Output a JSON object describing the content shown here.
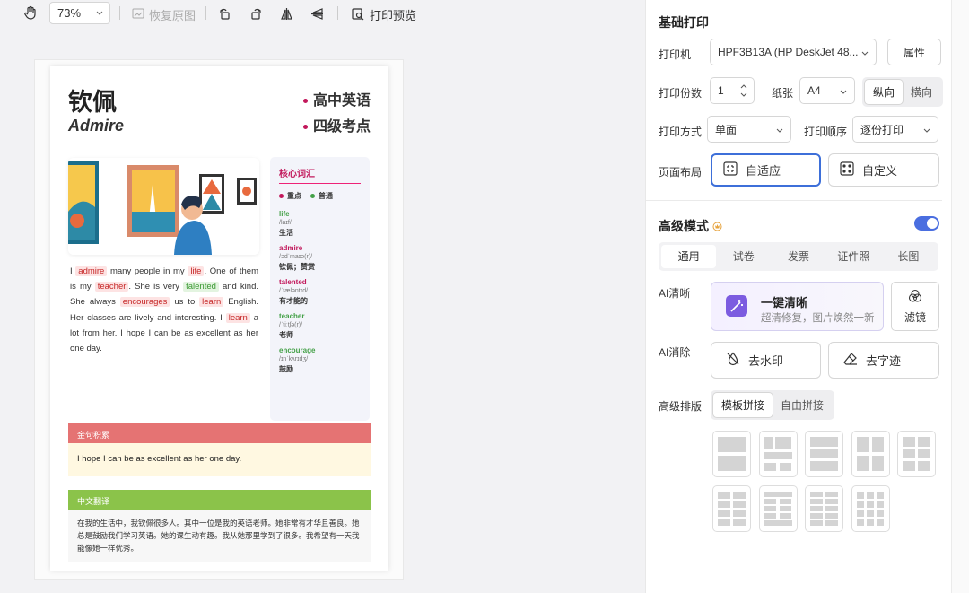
{
  "toolbar": {
    "zoom": "73%",
    "restore": "恢复原图",
    "preview": "打印预览"
  },
  "doc": {
    "title": "钦佩",
    "subtitle": "Admire",
    "tag1": "高中英语",
    "tag2": "四级考点",
    "para": [
      {
        "t": "I "
      },
      {
        "t": "admire",
        "h": "r"
      },
      {
        "t": " many people in my "
      },
      {
        "t": "life",
        "h": "r"
      },
      {
        "t": ". One of them is my "
      },
      {
        "t": "teacher",
        "h": "r"
      },
      {
        "t": ". She is very "
      },
      {
        "t": "talented",
        "h": "g"
      },
      {
        "t": " and kind. She always "
      },
      {
        "t": "encourages",
        "h": "r"
      },
      {
        "t": " us to "
      },
      {
        "t": "learn",
        "h": "r"
      },
      {
        "t": " English. Her classes are lively and interesting. I "
      },
      {
        "t": "learn",
        "h": "r"
      },
      {
        "t": " a lot from her. I hope I can be as excellent as her one day."
      }
    ],
    "vocab_title": "核心词汇",
    "legend_key": "重点",
    "legend_normal": "普通",
    "vocab": [
      {
        "word": "life",
        "phon": "/laɪf/",
        "mean": "生活",
        "color": "#43a047"
      },
      {
        "word": "admire",
        "phon": "/ədˈmaɪə(r)/",
        "mean": "钦佩；赞赏",
        "color": "#c2185b"
      },
      {
        "word": "talented",
        "phon": "/ˈtæləntɪd/",
        "mean": "有才能的",
        "color": "#c2185b"
      },
      {
        "word": "teacher",
        "phon": "/ˈtiːtʃə(r)/",
        "mean": "老师",
        "color": "#43a047"
      },
      {
        "word": "encourage",
        "phon": "/ɪnˈkʌrɪdʒ/",
        "mean": "鼓励",
        "color": "#43a047"
      }
    ],
    "quote_title": "金句积累",
    "quote": "I hope I can be as excellent as her one day.",
    "trans_title": "中文翻译",
    "trans": "在我的生活中，我钦佩很多人。其中一位是我的英语老师。她非常有才华且善良。她总是鼓励我们学习英语。她的课生动有趣。我从她那里学到了很多。我希望有一天我能像她一样优秀。"
  },
  "panel": {
    "basic": "基础打印",
    "printer_label": "打印机",
    "printer": "HPF3B13A (HP DeskJet 48...",
    "prop": "属性",
    "copies_label": "打印份数",
    "copies": "1",
    "paper_label": "纸张",
    "paper": "A4",
    "portrait": "纵向",
    "landscape": "横向",
    "mode_label": "打印方式",
    "mode": "单面",
    "order_label": "打印顺序",
    "order": "逐份打印",
    "layout_label": "页面布局",
    "fit": "自适应",
    "custom": "自定义",
    "adv": "高级模式",
    "tabs": [
      "通用",
      "试卷",
      "发票",
      "证件照",
      "长图"
    ],
    "ai_clear_label": "AI清晰",
    "ai_clear_title": "一键清晰",
    "ai_clear_desc": "超清修复，图片焕然一新",
    "filter": "滤镜",
    "ai_erase_label": "AI消除",
    "watermark": "去水印",
    "handwrite": "去字迹",
    "arr_label": "高级排版",
    "tpl": "模板拼接",
    "free": "自由拼接"
  }
}
